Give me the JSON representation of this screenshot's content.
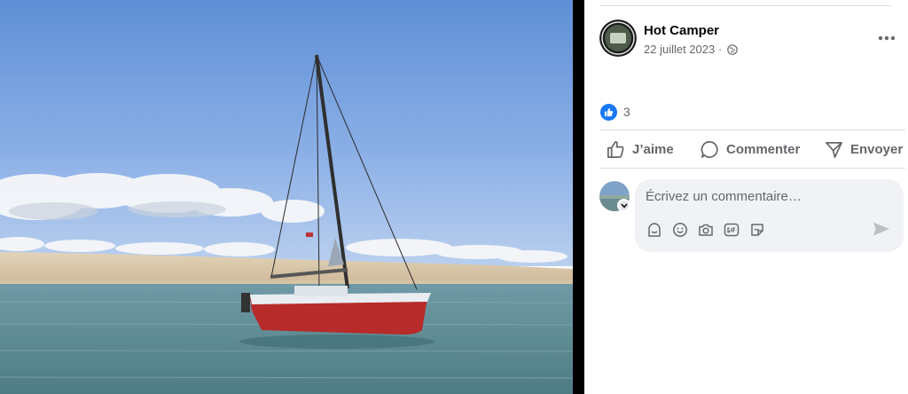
{
  "post": {
    "author": "Hot Camper",
    "date": "22 juillet 2023 ·",
    "privacy_icon": "globe-icon"
  },
  "reactions": {
    "count": "3",
    "icon": "like-icon"
  },
  "actions": {
    "like": "J’aime",
    "comment": "Commenter",
    "share": "Envoyer"
  },
  "comment": {
    "placeholder": "Écrivez un commentaire…"
  },
  "colors": {
    "accent": "#1877f2",
    "secondary_text": "#65676b",
    "comment_bg": "#f0f2f5",
    "divider": "#000000"
  }
}
